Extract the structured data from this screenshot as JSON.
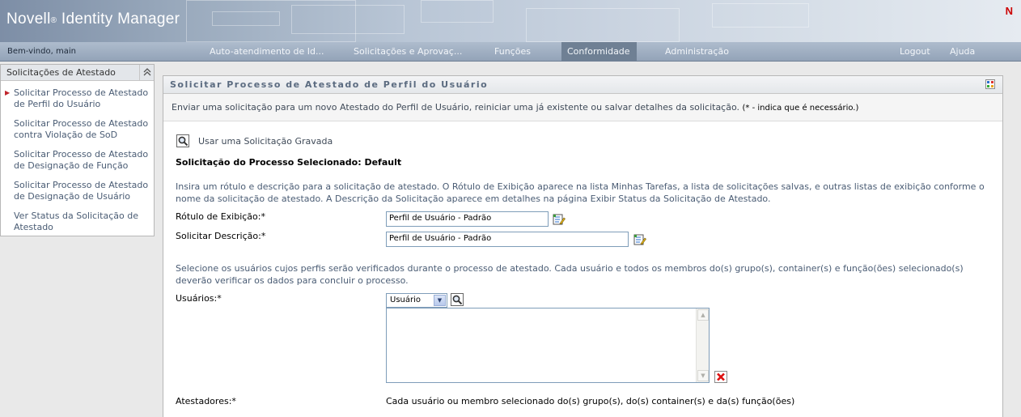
{
  "header": {
    "brand": "Novell",
    "brand_mark": "®",
    "product": "Identity Manager",
    "corner_logo": "N"
  },
  "navbar": {
    "welcome": "Bem-vindo, main",
    "tabs": [
      {
        "label": "Auto-atendimento de Id..."
      },
      {
        "label": "Solicitações e Aprovaç..."
      },
      {
        "label": "Funções"
      },
      {
        "label": "Conformidade",
        "active": true
      },
      {
        "label": "Administração"
      }
    ],
    "logout": "Logout",
    "help": "Ajuda"
  },
  "sidebar": {
    "title": "Solicitações de Atestado",
    "collapse_icon": "double-chevron-up-icon",
    "items": [
      {
        "label": "Solicitar Processo de Atestado de Perfil do Usuário",
        "active": true
      },
      {
        "label": "Solicitar Processo de Atestado contra Violação de SoD"
      },
      {
        "label": "Solicitar Processo de Atestado de Designação de Função"
      },
      {
        "label": "Solicitar Processo de Atestado de Designação de Usuário"
      },
      {
        "label": "Ver Status da Solicitação de Atestado"
      }
    ]
  },
  "panel": {
    "title": "Solicitar Processo de Atestado de Perfil do Usuário",
    "intro": "Enviar uma solicitação para um novo Atestado do Perfil de Usuário, reiniciar uma já existente ou salvar detalhes da solicitação.",
    "intro_note": "(* - indica que é necessário.)",
    "use_saved": "Usar uma Solicitação Gravada",
    "selected_process": "Solicitação do Processo Selecionado: Default",
    "help_text_1": "Insira um rótulo e descrição para a solicitação de atestado. O Rótulo de Exibição aparece na lista Minhas Tarefas, a lista de solicitações salvas, e outras listas de exibição conforme o nome da solicitação de atestado. A Descrição da Solicitação aparece em detalhes na página Exibir Status da Solicitação de Atestado.",
    "display_label_label": "Rótulo de Exibição:*",
    "display_label_value": "Perfil de Usuário - Padrão",
    "description_label": "Solicitar Descrição:*",
    "description_value": "Perfil de Usuário - Padrão",
    "help_text_2": "Selecione os usuários cujos perfis serão verificados durante o processo de atestado. Cada usuário e todos os membros do(s) grupo(s), container(s) e função(ões) selecionado(s) deverão verificar os dados para concluir o processo.",
    "users_label": "Usuários:*",
    "users_type_selected": "Usuário",
    "attesters_label": "Atestadores:*",
    "attesters_value": "Cada usuário ou membro selecionado do(s) grupo(s), do(s) container(s) e da(s) função(ões)"
  },
  "colors": {
    "nav_active": "#6f8094",
    "sidebar_link": "#4a5c74",
    "active_marker": "#c0242b",
    "panel_title": "#5b6b80",
    "logo_red": "#cc0000"
  }
}
